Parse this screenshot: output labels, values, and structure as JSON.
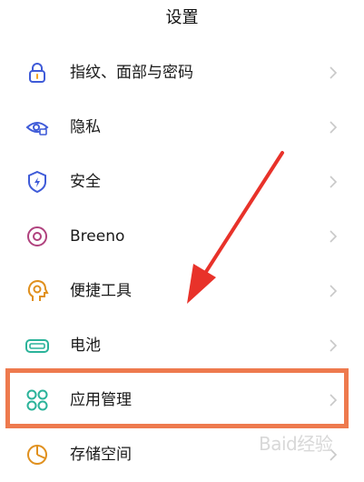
{
  "header": {
    "title": "设置"
  },
  "items": [
    {
      "label": "指纹、面部与密码",
      "icon": "lock-icon"
    },
    {
      "label": "隐私",
      "icon": "privacy-eye-icon"
    },
    {
      "label": "安全",
      "icon": "shield-icon"
    },
    {
      "label": "Breeno",
      "icon": "breeno-icon"
    },
    {
      "label": "便捷工具",
      "icon": "tools-head-icon"
    },
    {
      "label": "电池",
      "icon": "battery-icon"
    },
    {
      "label": "应用管理",
      "icon": "app-grid-icon"
    },
    {
      "label": "存储空间",
      "icon": "storage-pie-icon"
    }
  ],
  "watermark": {
    "text": "Baid经验"
  },
  "colors": {
    "accent": "#4a6cf7",
    "highlight_border": "#ee7a4e",
    "arrow": "#e8322a",
    "chevron": "#c8c8c8"
  }
}
